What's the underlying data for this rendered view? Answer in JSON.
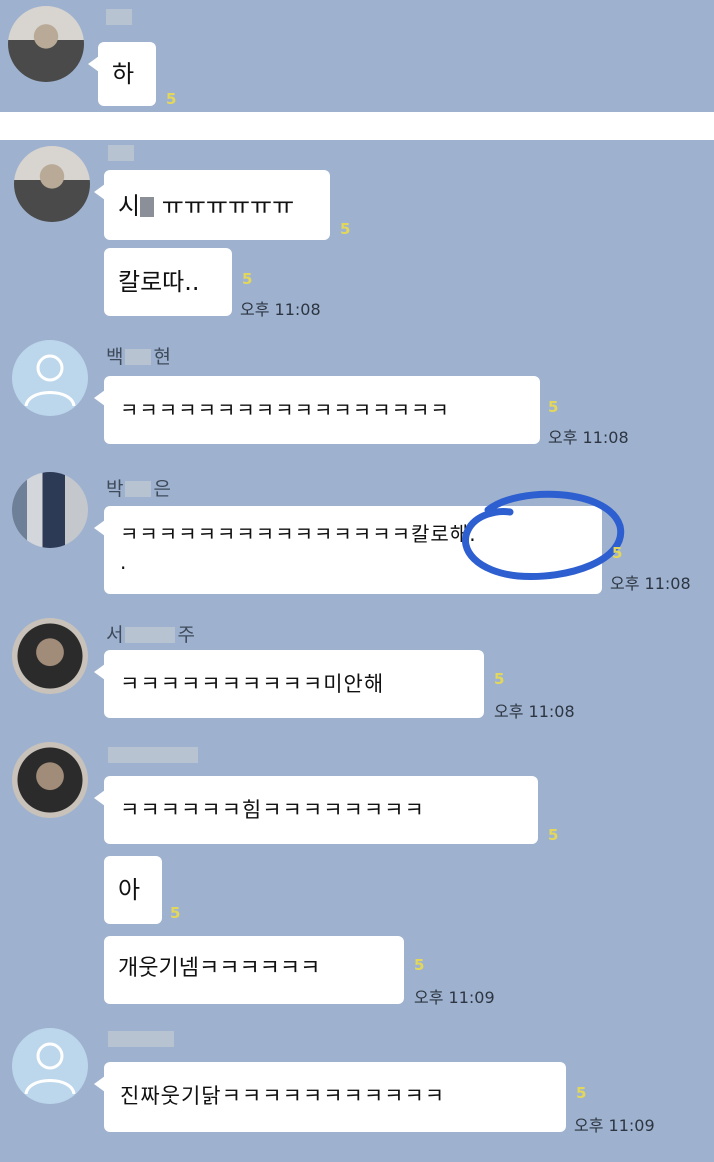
{
  "top": {
    "message": "하",
    "unread": "5"
  },
  "main": {
    "group1": {
      "msg1_prefix": "시",
      "msg1_suffix": "ㅠㅠㅠㅠㅠㅠ",
      "msg1_unread": "5",
      "msg2": "칼로따..",
      "msg2_unread": "5",
      "time": "오후 11:08"
    },
    "group2": {
      "sender_first": "백",
      "sender_last": "현",
      "message": "ㅋㅋㅋㅋㅋㅋㅋㅋㅋㅋㅋㅋㅋㅋㅋㅋㅋ",
      "unread": "5",
      "time": "오후 11:08"
    },
    "group3": {
      "sender_first": "박",
      "sender_last": "은",
      "message_line1": "ㅋㅋㅋㅋㅋㅋㅋㅋㅋㅋㅋㅋㅋㅋㅋ칼로해.",
      "message_line2": ".",
      "unread": "5",
      "time": "오후 11:08",
      "annotation_color": "#2d5fd0"
    },
    "group4": {
      "sender_first": "서",
      "sender_last": "주",
      "message": "ㅋㅋㅋㅋㅋㅋㅋㅋㅋㅋ미안해",
      "unread": "5",
      "time": "오후 11:08"
    },
    "group5": {
      "msg1": "ㅋㅋㅋㅋㅋㅋ힘ㅋㅋㅋㅋㅋㅋㅋㅋ",
      "msg1_unread": "5",
      "msg2": "아",
      "msg2_unread": "5",
      "msg3": "개웃기넴ㅋㅋㅋㅋㅋㅋ",
      "msg3_unread": "5",
      "time": "오후 11:09"
    },
    "group6": {
      "message": "진짜웃기닭ㅋㅋㅋㅋㅋㅋㅋㅋㅋㅋㅋ",
      "unread": "5",
      "time": "오후 11:09"
    }
  },
  "colors": {
    "chat_background": "#9eb2cf",
    "bubble": "#ffffff",
    "unread_count": "#e3d75b"
  }
}
